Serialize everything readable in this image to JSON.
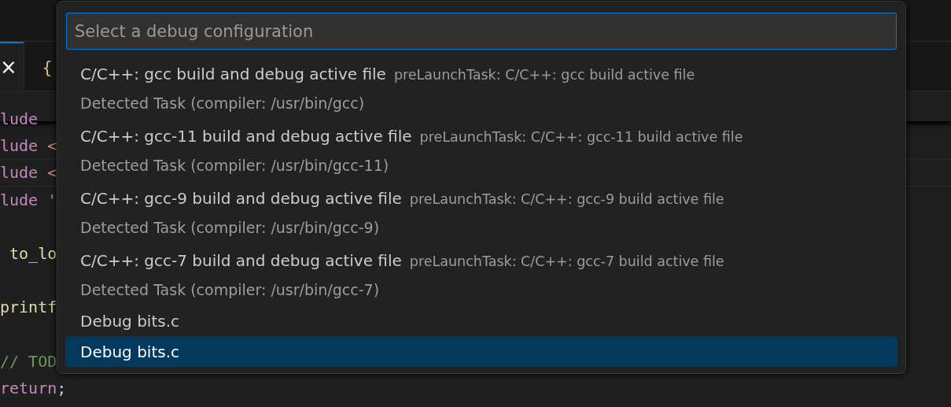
{
  "editor": {
    "tabs": [
      {
        "kind": "close",
        "label": "×",
        "selected": true
      },
      {
        "kind": "json",
        "label": "{",
        "selected": false
      }
    ],
    "code_lines": [
      {
        "parts": [
          {
            "kind": "keyword",
            "text": "lude"
          }
        ]
      },
      {
        "parts": [
          {
            "kind": "keyword",
            "text": "lude"
          },
          {
            "kind": "string",
            "text": " <"
          }
        ]
      },
      {
        "parts": [
          {
            "kind": "keyword",
            "text": "lude"
          },
          {
            "kind": "string",
            "text": " <"
          }
        ]
      },
      {
        "parts": [
          {
            "kind": "keyword",
            "text": "lude"
          },
          {
            "kind": "string",
            "text": " '"
          }
        ]
      },
      {
        "parts": [
          {
            "kind": "function",
            "text": " to_lo"
          }
        ]
      },
      {
        "parts": [
          {
            "kind": "function",
            "text": "printf"
          }
        ]
      },
      {
        "parts": [
          {
            "kind": "comment",
            "text": "// TOD"
          }
        ]
      },
      {
        "parts": [
          {
            "kind": "keyword",
            "text": "return"
          },
          {
            "kind": "plain",
            "text": ";"
          }
        ]
      }
    ]
  },
  "quick_pick": {
    "placeholder": "Select a debug configuration",
    "items": [
      {
        "label": "C/C++: gcc build and debug active file",
        "description": "preLaunchTask: C/C++: gcc build active file",
        "detail": "Detected Task (compiler: /usr/bin/gcc)",
        "selected": false
      },
      {
        "label": "C/C++: gcc-11 build and debug active file",
        "description": "preLaunchTask: C/C++: gcc-11 build active file",
        "detail": "Detected Task (compiler: /usr/bin/gcc-11)",
        "selected": false
      },
      {
        "label": "C/C++: gcc-9 build and debug active file",
        "description": "preLaunchTask: C/C++: gcc-9 build active file",
        "detail": "Detected Task (compiler: /usr/bin/gcc-9)",
        "selected": false
      },
      {
        "label": "C/C++: gcc-7 build and debug active file",
        "description": "preLaunchTask: C/C++: gcc-7 build active file",
        "detail": "Detected Task (compiler: /usr/bin/gcc-7)",
        "selected": false
      },
      {
        "label": "Debug bits.c",
        "selected": false
      },
      {
        "label": "Debug bits.c",
        "selected": true
      }
    ]
  }
}
